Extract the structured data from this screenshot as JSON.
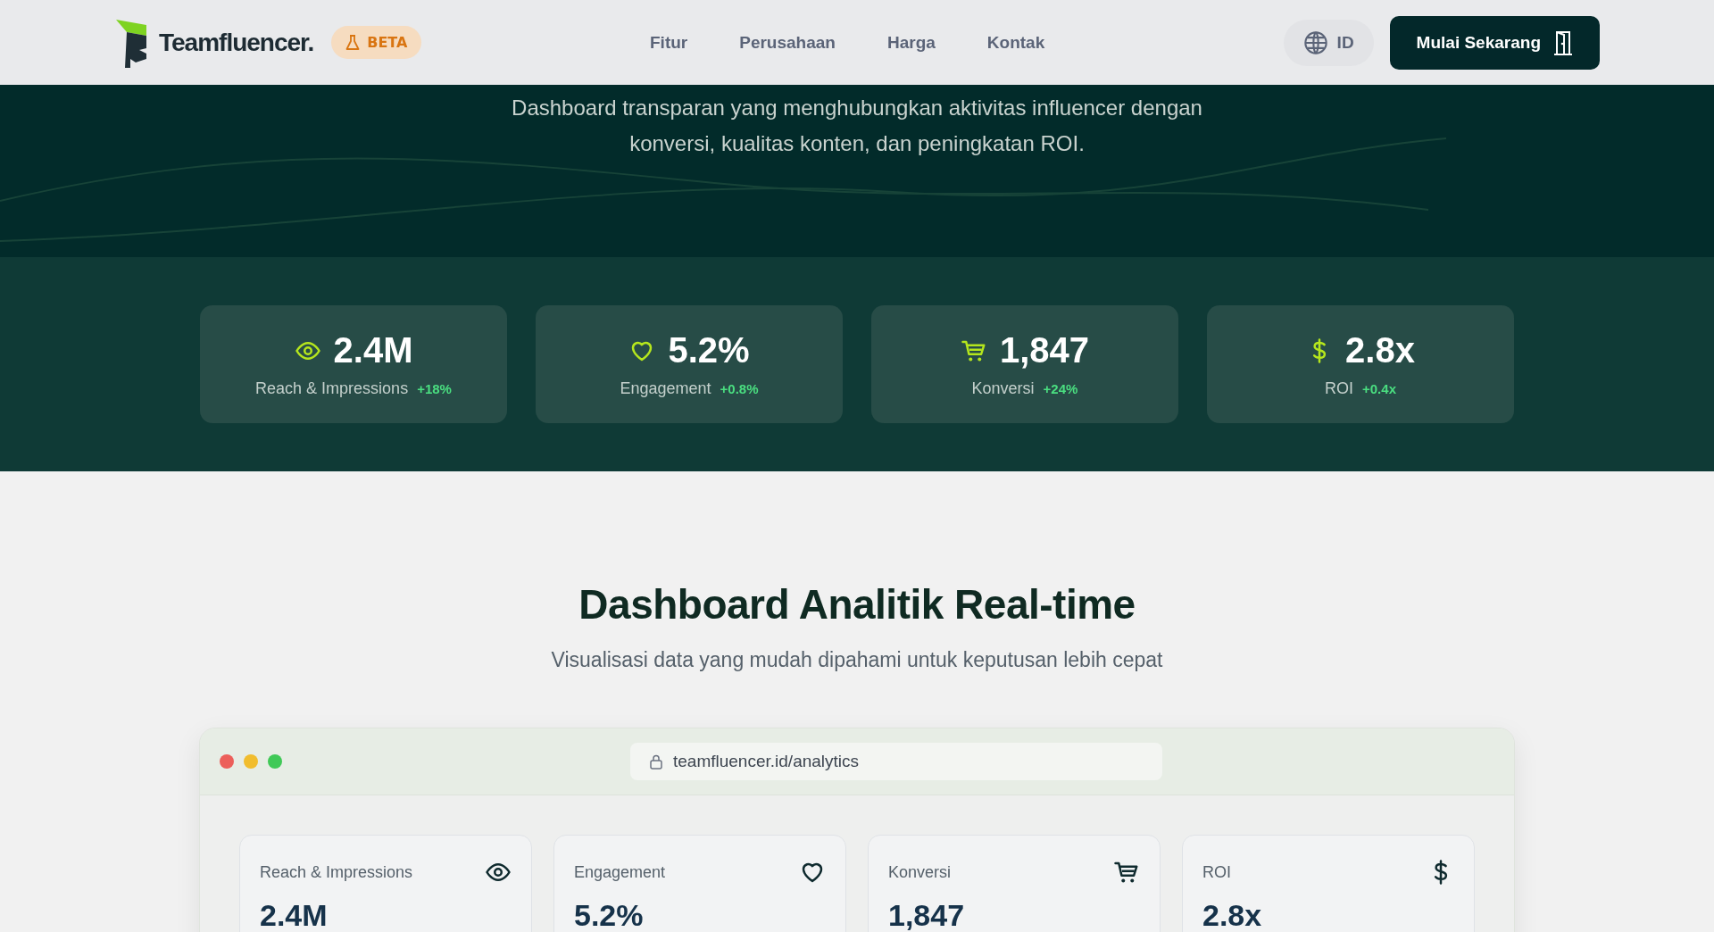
{
  "header": {
    "brand": "Teamfluencer.",
    "badge": "BETA",
    "nav": [
      {
        "label": "Fitur"
      },
      {
        "label": "Perusahaan"
      },
      {
        "label": "Harga"
      },
      {
        "label": "Kontak"
      }
    ],
    "language": "ID",
    "cta": "Mulai Sekarang"
  },
  "hero": {
    "lines": [
      "Dashboard transparan yang menghubungkan aktivitas influencer dengan",
      "konversi, kualitas konten, dan peningkatan ROI."
    ],
    "stats": [
      {
        "kind": "eye",
        "value": "2.4M",
        "label": "Reach & Impressions",
        "delta": "+18%"
      },
      {
        "kind": "heart",
        "value": "5.2%",
        "label": "Engagement",
        "delta": "+0.8%"
      },
      {
        "kind": "cart",
        "value": "1,847",
        "label": "Konversi",
        "delta": "+24%"
      },
      {
        "kind": "dollar",
        "value": "2.8x",
        "label": "ROI",
        "delta": "+0.4x"
      }
    ]
  },
  "dashboard": {
    "title": "Dashboard Analitik Real-time",
    "subtitle": "Visualisasi data yang mudah dipahami untuk keputusan lebih cepat",
    "url": "teamfluencer.id/analytics",
    "cards": [
      {
        "kind": "eye",
        "label": "Reach & Impressions",
        "value": "2.4M"
      },
      {
        "kind": "heart",
        "label": "Engagement",
        "value": "5.2%"
      },
      {
        "kind": "cart",
        "label": "Konversi",
        "value": "1,847"
      },
      {
        "kind": "dollar",
        "label": "ROI",
        "value": "2.8x"
      }
    ]
  }
}
